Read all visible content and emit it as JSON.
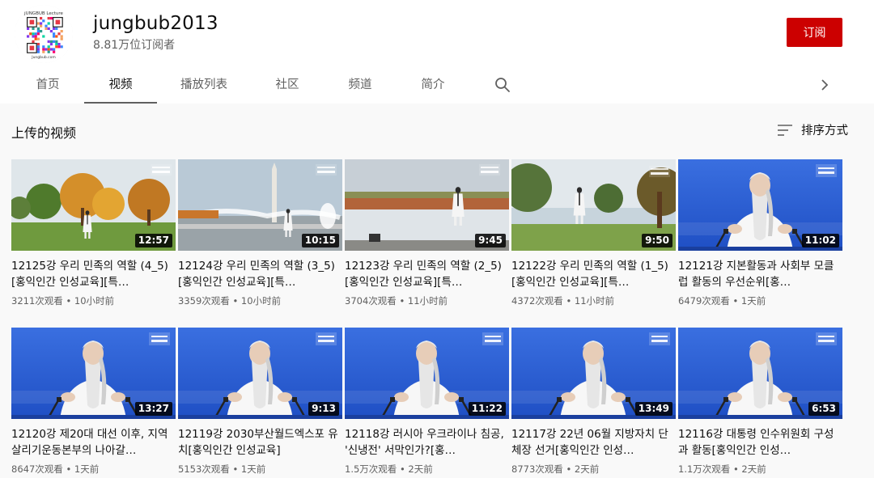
{
  "channel": {
    "name": "jungbub2013",
    "subscribers": "8.81万位订阅者",
    "subscribe_label": "订阅",
    "logo_text_top": "JUNGBUB Lecture",
    "logo_text_bottom": "Jungbub.com"
  },
  "tabs": [
    {
      "label": "首页",
      "active": false
    },
    {
      "label": "视频",
      "active": true
    },
    {
      "label": "播放列表",
      "active": false
    },
    {
      "label": "社区",
      "active": false
    },
    {
      "label": "频道",
      "active": false
    },
    {
      "label": "简介",
      "active": false
    }
  ],
  "icons": {
    "search": "search-icon",
    "next": "chevron-right-icon",
    "sort": "sort-icon"
  },
  "section": {
    "title": "上传的视频",
    "sort_label": "排序方式"
  },
  "colors": {
    "subscribe": "#cc0000",
    "studio_blue": "#2a5bd8"
  },
  "videos": [
    {
      "title": "12125강 우리 민족의 역할 (4_5)[홍익인간 인성교육][특…",
      "duration": "12:57",
      "views": "3211次观看",
      "age": "10小时前",
      "scene": "autumn"
    },
    {
      "title": "12124강 우리 민족의 역할 (3_5)[홍익인간 인성교육][특…",
      "duration": "10:15",
      "views": "3359次观看",
      "age": "10小时前",
      "scene": "fountain"
    },
    {
      "title": "12123강 우리 민족의 역할 (2_5)[홍익인간 인성교육][특…",
      "duration": "9:45",
      "views": "3704次观看",
      "age": "11小时前",
      "scene": "lake"
    },
    {
      "title": "12122강 우리 민족의 역할 (1_5)[홍익인간 인성교육][특…",
      "duration": "9:50",
      "views": "4372次观看",
      "age": "11小时前",
      "scene": "park"
    },
    {
      "title": "12121강 지본활동과 사회부 모클럽 활동의 우선순위[홍…",
      "duration": "11:02",
      "views": "6479次观看",
      "age": "1天前",
      "scene": "studio"
    },
    {
      "title": "12120강 제20대 대선 이후, 지역살리기운동본부의 나아갈…",
      "duration": "13:27",
      "views": "8647次观看",
      "age": "1天前",
      "scene": "studio"
    },
    {
      "title": "12119강 2030부산월드엑스포 유치[홍익인간 인성교육]",
      "duration": "9:13",
      "views": "5153次观看",
      "age": "1天前",
      "scene": "studio"
    },
    {
      "title": "12118강 러시아 우크라이나 침공, '신냉전' 서막인가?[홍…",
      "duration": "11:22",
      "views": "1.5万次观看",
      "age": "2天前",
      "scene": "studio"
    },
    {
      "title": "12117강 22년 06월 지방자치 단체장 선거[홍익인간 인성…",
      "duration": "13:49",
      "views": "8773次观看",
      "age": "2天前",
      "scene": "studio"
    },
    {
      "title": "12116강 대통령 인수위원회 구성과 활동[홍익인간 인성…",
      "duration": "6:53",
      "views": "1.1万次观看",
      "age": "2天前",
      "scene": "studio"
    }
  ]
}
